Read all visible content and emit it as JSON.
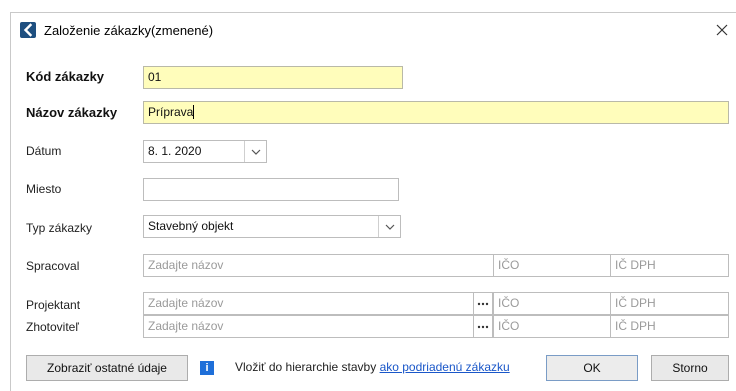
{
  "window": {
    "title": "Založenie zákazky(zmenené)"
  },
  "form": {
    "kod": {
      "label": "Kód zákazky",
      "value": "01"
    },
    "nazov": {
      "label": "Názov zákazky",
      "value": "Príprava"
    },
    "datum": {
      "label": "Dátum",
      "value": "8. 1. 2020"
    },
    "miesto": {
      "label": "Miesto",
      "value": ""
    },
    "typ": {
      "label": "Typ zákazky",
      "value": "Stavebný objekt"
    },
    "spracoval": {
      "label": "Spracoval",
      "name_placeholder": "Zadajte názov",
      "ico_placeholder": "IČO",
      "icdph_placeholder": "IČ DPH"
    },
    "projektant": {
      "label": "Projektant",
      "name_placeholder": "Zadajte názov",
      "ico_placeholder": "IČO",
      "icdph_placeholder": "IČ DPH"
    },
    "zhotovitel": {
      "label": "Zhotoviteľ",
      "name_placeholder": "Zadajte názov",
      "ico_placeholder": "IČO",
      "icdph_placeholder": "IČ DPH"
    }
  },
  "footer": {
    "show_more_label": "Zobraziť ostatné údaje",
    "info_icon_text": "i",
    "hierarchy_text": "Vložiť do hierarchie stavby",
    "hierarchy_link": "ako podriadenú zákazku",
    "ok_label": "OK",
    "cancel_label": "Storno"
  },
  "colors": {
    "accent": "#1e4f80",
    "required_field_bg": "#fffdbb",
    "link": "#1a57c9",
    "info": "#1e6fd9"
  },
  "icons": {
    "app": "chevron-left-icon",
    "close": "close-icon",
    "dropdown": "chevron-down-icon",
    "browse": "ellipsis-icon",
    "info": "info-icon"
  }
}
